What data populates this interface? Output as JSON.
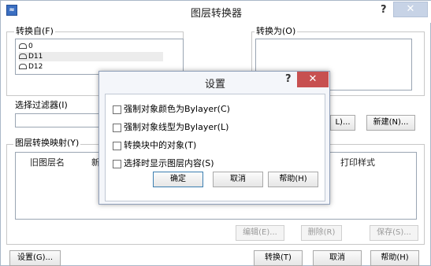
{
  "window": {
    "title": "图层转换器",
    "help": "?",
    "close": "✕",
    "icon": "layer-translator-icon"
  },
  "convert_from": {
    "label": "转换自(F)",
    "items": [
      {
        "name": "0"
      },
      {
        "name": "D11"
      },
      {
        "name": "D12"
      }
    ]
  },
  "convert_to": {
    "label": "转换为(O)"
  },
  "filter": {
    "label": "选择过滤器(I)",
    "value": ""
  },
  "buttons_right": {
    "load_partial": "L)...",
    "new": "新建(N)..."
  },
  "mapping": {
    "label": "图层转换映射(Y)",
    "columns": {
      "old_layer": "旧图层名",
      "new_partial": "新",
      "plot_style": "打印样式"
    },
    "edit": "编辑(E)...",
    "delete": "删除(R)",
    "save": "保存(S)..."
  },
  "footer": {
    "settings": "设置(G)...",
    "translate": "转换(T)",
    "cancel": "取消",
    "help": "帮助(H)"
  },
  "dialog": {
    "title": "设置",
    "help": "?",
    "close": "✕",
    "options": [
      {
        "label": "强制对象颜色为Bylayer(C)",
        "checked": false
      },
      {
        "label": "强制对象线型为Bylayer(L)",
        "checked": false
      },
      {
        "label": "转换块中的对象(T)",
        "checked": false
      },
      {
        "label": "选择时显示图层内容(S)",
        "checked": false
      }
    ],
    "ok": "确定",
    "cancel": "取消",
    "help_btn": "帮助(H)"
  }
}
